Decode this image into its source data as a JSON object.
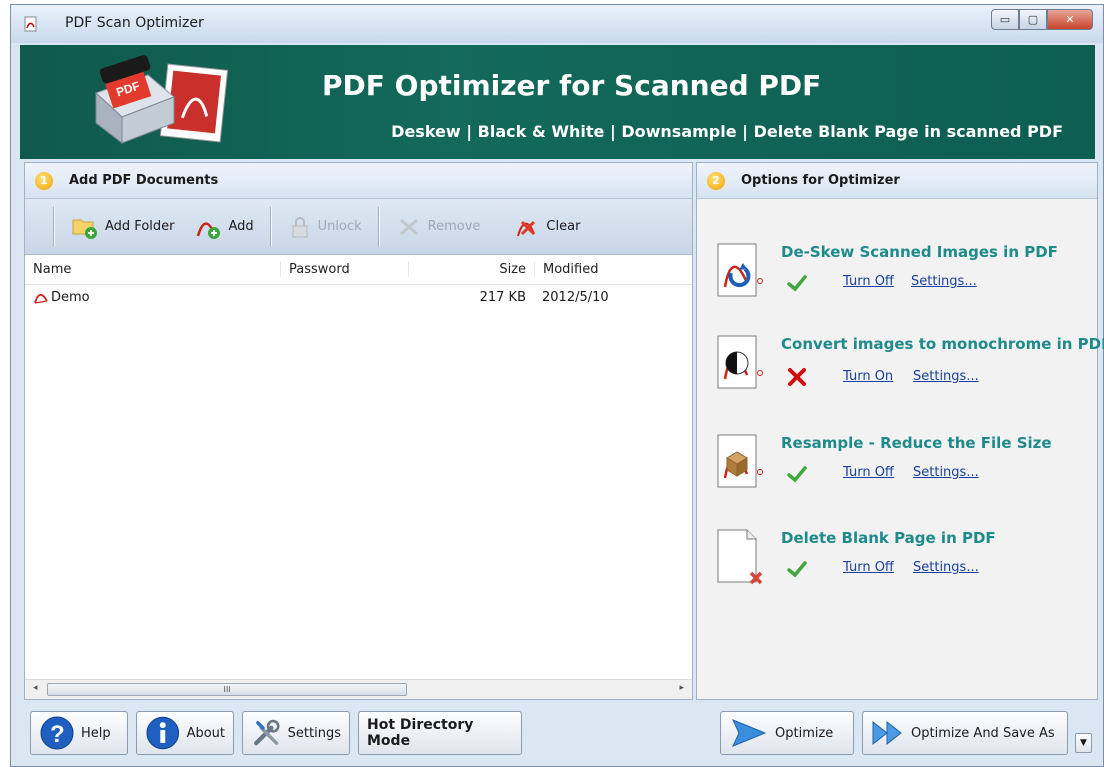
{
  "window": {
    "title": "PDF Scan Optimizer",
    "minimize_glyph": "▭",
    "maximize_glyph": "▢",
    "close_glyph": "✕"
  },
  "banner": {
    "title": "PDF Optimizer for Scanned PDF",
    "subtitle": "Deskew | Black & White | Downsample | Delete Blank Page in scanned PDF",
    "art_label": "PDF"
  },
  "left_panel": {
    "step": "1",
    "header": "Add PDF Documents",
    "toolbar": {
      "add_folder": "Add Folder",
      "add": "Add",
      "unlock": "Unlock",
      "remove": "Remove",
      "clear": "Clear"
    },
    "columns": {
      "name": "Name",
      "password": "Password",
      "size": "Size",
      "modified": "Modified"
    },
    "files": [
      {
        "name": "Demo",
        "password": "",
        "size": "217 KB",
        "modified": "2012/5/10"
      }
    ],
    "scroll_thumb": "III"
  },
  "right_panel": {
    "step": "2",
    "header": "Options for Optimizer",
    "options": [
      {
        "title": "De-Skew Scanned Images in PDF",
        "enabled": true,
        "toggle": "Turn Off",
        "settings": "Settings..."
      },
      {
        "title": "Convert images to monochrome in PDF",
        "enabled": false,
        "toggle": "Turn On",
        "settings": "Settings..."
      },
      {
        "title": "Resample - Reduce the File Size",
        "enabled": true,
        "toggle": "Turn Off",
        "settings": "Settings..."
      },
      {
        "title": "Delete Blank Page in PDF",
        "enabled": true,
        "toggle": "Turn Off",
        "settings": "Settings..."
      }
    ]
  },
  "bottom": {
    "help": "Help",
    "about": "About",
    "settings": "Settings",
    "hot_directory": "Hot Directory Mode",
    "optimize": "Optimize",
    "optimize_save_as": "Optimize And Save As"
  },
  "colors": {
    "banner": "#13695a",
    "option_title": "#1e8a8a",
    "link": "#1a3fa0",
    "enabled_check": "#3ea83e",
    "disabled_cross": "#d01010"
  }
}
